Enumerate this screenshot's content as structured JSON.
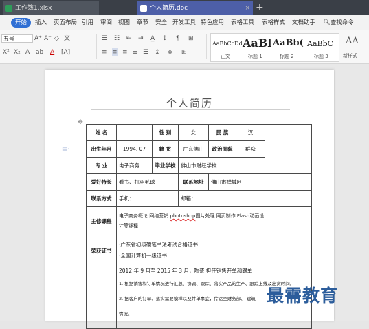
{
  "titlebar": {
    "tabs": [
      {
        "label": "工作簿1.xlsx"
      },
      {
        "label": "个人简历.doc"
      }
    ],
    "new_tab": "+",
    "close": "×"
  },
  "menubar": {
    "items": [
      "开始",
      "插入",
      "页面布局",
      "引用",
      "审阅",
      "视图",
      "章节",
      "安全",
      "开发工具",
      "特色应用",
      "表格工具",
      "表格样式",
      "文档助手"
    ],
    "search": "查找命令"
  },
  "ribbon": {
    "font_name": "五号",
    "styles": [
      {
        "sample": "AaBbCcDd",
        "label": "正文"
      },
      {
        "sample": "AaBl",
        "label": "标题 1"
      },
      {
        "sample": "AaBb(",
        "label": "标题 2"
      },
      {
        "sample": "AaBbC",
        "label": "标题 3"
      }
    ],
    "new_style": {
      "sample": "AA",
      "label": "新样式"
    }
  },
  "document": {
    "title": "个人简历",
    "table": {
      "name_label": "姓   名",
      "gender_label": "性   别",
      "gender_value": "女",
      "ethnicity_label": "民   族",
      "ethnicity_value": "汉",
      "birth_label": "出生年月",
      "birth_value": "1994. 07",
      "origin_label": "籍   贯",
      "origin_value": "广东佛山",
      "political_label": "政治面貌",
      "political_value": "群众",
      "major_label": "专   业",
      "major_value": "电子商务",
      "school_label": "毕业学校",
      "school_value": "佛山市财经学校",
      "hobby_label": "爱好特长",
      "hobby_value": "看书、打羽毛球",
      "address_label": "联系地址",
      "address_value": "佛山市禅城区",
      "contact_label": "联系方式",
      "phone_label": "手机：",
      "email_label": "邮箱：",
      "courses_label": "主修课程",
      "courses_line1_a": "电子商务概论    网络营销    ",
      "courses_line1_b": "photoshop",
      "courses_line1_c": "图片处理    网页制作    Flash动画设",
      "courses_line2": "计等课程",
      "certs_label": "荣获证书",
      "cert1": "·广东省初级硬笔书法考试合格证书",
      "cert2": "·全国计算机一级证书",
      "exp_line1": "2012 年 9 月至 2015 年 3 月，陶瓷 担任销售开单和跟单",
      "exp_line2": "1. 根据销售和订单情况进行汇总、协调、跟踪、落实产品的生产、跟踪上线及出货时间。",
      "exp_line3": "2. 把客户的订单、落实需要模样以及并单事宜，传达至财务部、 建筑",
      "exp_line4": "情况。"
    }
  },
  "watermark": "最需教育"
}
